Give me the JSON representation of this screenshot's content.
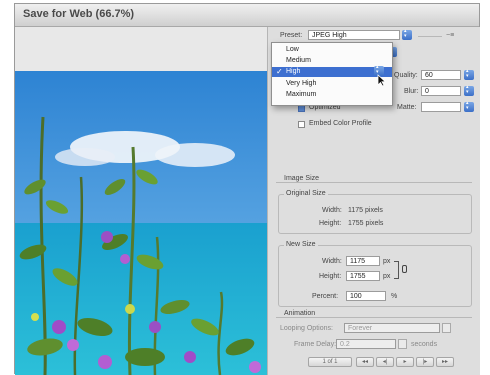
{
  "window": {
    "title": "Save for Web (66.7%)"
  },
  "settings": {
    "preset_label": "Preset:",
    "preset_value": "JPEG High",
    "format_hint": "−≡",
    "quality_label": "Quality:",
    "quality_value": "60",
    "blur_label": "Blur:",
    "blur_value": "0",
    "matte_label": "Matte:",
    "matte_value": "",
    "optimized_label": "Optimized",
    "embed_profile_label": "Embed Color Profile"
  },
  "quality_dropdown": {
    "options": [
      {
        "label": "Low",
        "selected": false
      },
      {
        "label": "Medium",
        "selected": false
      },
      {
        "label": "High",
        "selected": true
      },
      {
        "label": "Very High",
        "selected": false
      },
      {
        "label": "Maximum",
        "selected": false
      }
    ],
    "check_glyph": "✓"
  },
  "image_size": {
    "section_label": "Image Size",
    "original_label": "Original Size",
    "orig_width_label": "Width:",
    "orig_width_value": "1175 pixels",
    "orig_height_label": "Height:",
    "orig_height_value": "1755 pixels",
    "new_label": "New Size",
    "new_width_label": "Width:",
    "new_width_value": "1175",
    "new_height_label": "Height:",
    "new_height_value": "1755",
    "unit": "px",
    "percent_label": "Percent:",
    "percent_value": "100",
    "percent_unit": "%"
  },
  "animation": {
    "section_label": "Animation",
    "looping_label": "Looping Options:",
    "looping_value": "Forever",
    "delay_label": "Frame Delay:",
    "delay_value": "0.2",
    "delay_unit": "seconds",
    "frame_counter": "1 of 1",
    "buttons": [
      "◂◂",
      "◂|",
      "▸",
      "|▸",
      "▸▸"
    ]
  },
  "colors": {
    "accent": "#3d6fd0",
    "sky": "#3f95d8",
    "sea": "#1fa6c9"
  }
}
